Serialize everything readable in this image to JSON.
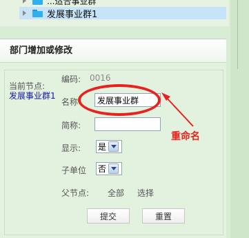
{
  "tree": {
    "prev_item_label": "...适合事业群",
    "selected_item_label": "发展事业群1"
  },
  "form": {
    "title": "部门增加或修改",
    "current_node_label": "当前节点:",
    "current_node_value": "发展事业群1",
    "code_label": "编码:",
    "code_value": "0016",
    "name_label": "名称",
    "name_value": "发展事业群",
    "abbr_label": "简称:",
    "abbr_value": "",
    "display_label": "显示:",
    "display_selected": "是",
    "sub_unit_label": "子单位",
    "sub_unit_selected": "否",
    "parent_label": "父节点:",
    "parent_value": "全部",
    "choose_link": "选择",
    "submit_label": "提交",
    "reset_label": "重置"
  },
  "annotation": {
    "text": "重命名",
    "color": "#e8231f"
  },
  "icons": {
    "tree_expand": "triangle-right-icon",
    "tree_folder": "folder-icon",
    "select_dropdown": "chevron-down-icon"
  }
}
